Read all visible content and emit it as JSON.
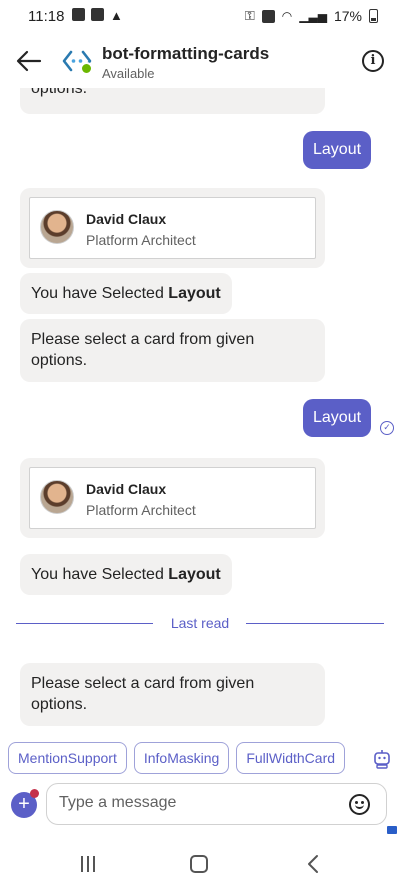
{
  "status_bar": {
    "time": "11:18",
    "battery": "17%"
  },
  "header": {
    "title": "bot-formatting-cards",
    "status": "Available",
    "info_glyph": "i"
  },
  "card_profile": {
    "name": "David Claux",
    "role": "Platform Architect"
  },
  "messages": {
    "m0_partial": "options.",
    "sent_1": "Layout",
    "selected_prefix": "You have Selected ",
    "selected_bold": "Layout",
    "prompt": "Please select a card from given options.",
    "sent_2": "Layout",
    "sent_2_check": "✓"
  },
  "last_read": "Last read",
  "suggestions": [
    "MentionSupport",
    "InfoMasking",
    "FullWidthCard"
  ],
  "compose": {
    "placeholder": "Type a message",
    "plus": "+"
  },
  "colors": {
    "accent": "#5b5fc7",
    "bubble": "#f2f1f0",
    "presence": "#6bb700"
  }
}
